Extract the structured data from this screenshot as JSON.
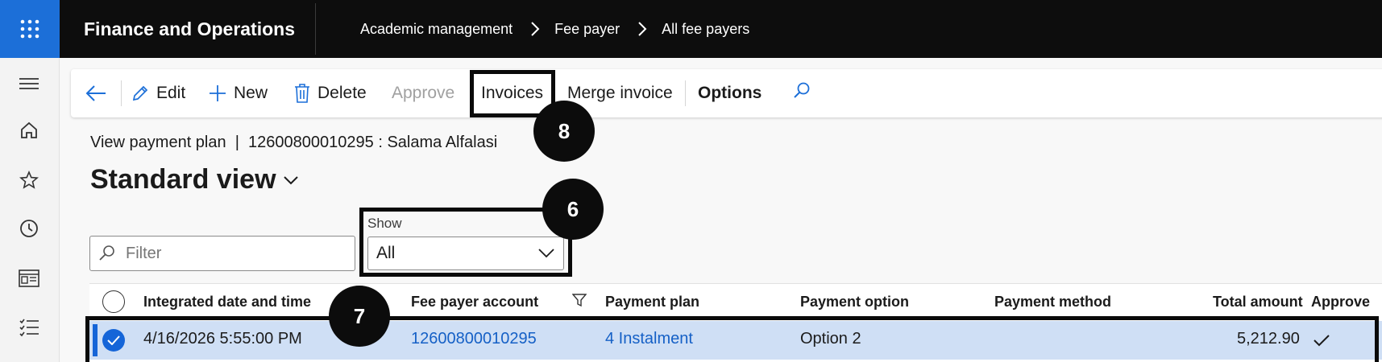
{
  "header": {
    "app_title": "Finance and Operations",
    "breadcrumbs": [
      "Academic management",
      "Fee payer",
      "All fee payers"
    ]
  },
  "rail": {
    "icons": [
      "menu-icon",
      "home-icon",
      "star-icon",
      "clock-icon",
      "workspace-icon",
      "list-icon"
    ]
  },
  "actions": {
    "edit": "Edit",
    "new": "New",
    "delete": "Delete",
    "approve": "Approve",
    "invoices": "Invoices",
    "merge_invoice": "Merge invoice",
    "options": "Options"
  },
  "page": {
    "subhead": "View payment plan  |  12600800010295 : Salama Alfalasi",
    "view_title": "Standard view"
  },
  "filter": {
    "placeholder": "Filter"
  },
  "show": {
    "label": "Show",
    "value": "All"
  },
  "grid": {
    "columns": [
      "Integrated date and time",
      "Fee payer account",
      "Payment plan",
      "Payment option",
      "Payment method",
      "Total amount",
      "Approve"
    ],
    "rows": [
      {
        "integrated_date": "4/16/2026 5:55:00 PM",
        "fee_payer_account": "12600800010295",
        "payment_plan": "4 Instalment",
        "payment_option": "Option 2",
        "payment_method": "",
        "total_amount": "5,212.90",
        "approved": true
      }
    ]
  },
  "callouts": {
    "invoices": "8",
    "show": "6",
    "row": "7"
  },
  "colors": {
    "accent": "#1c6fd8",
    "selected_row": "#cfdff5",
    "link": "#1560c6"
  }
}
